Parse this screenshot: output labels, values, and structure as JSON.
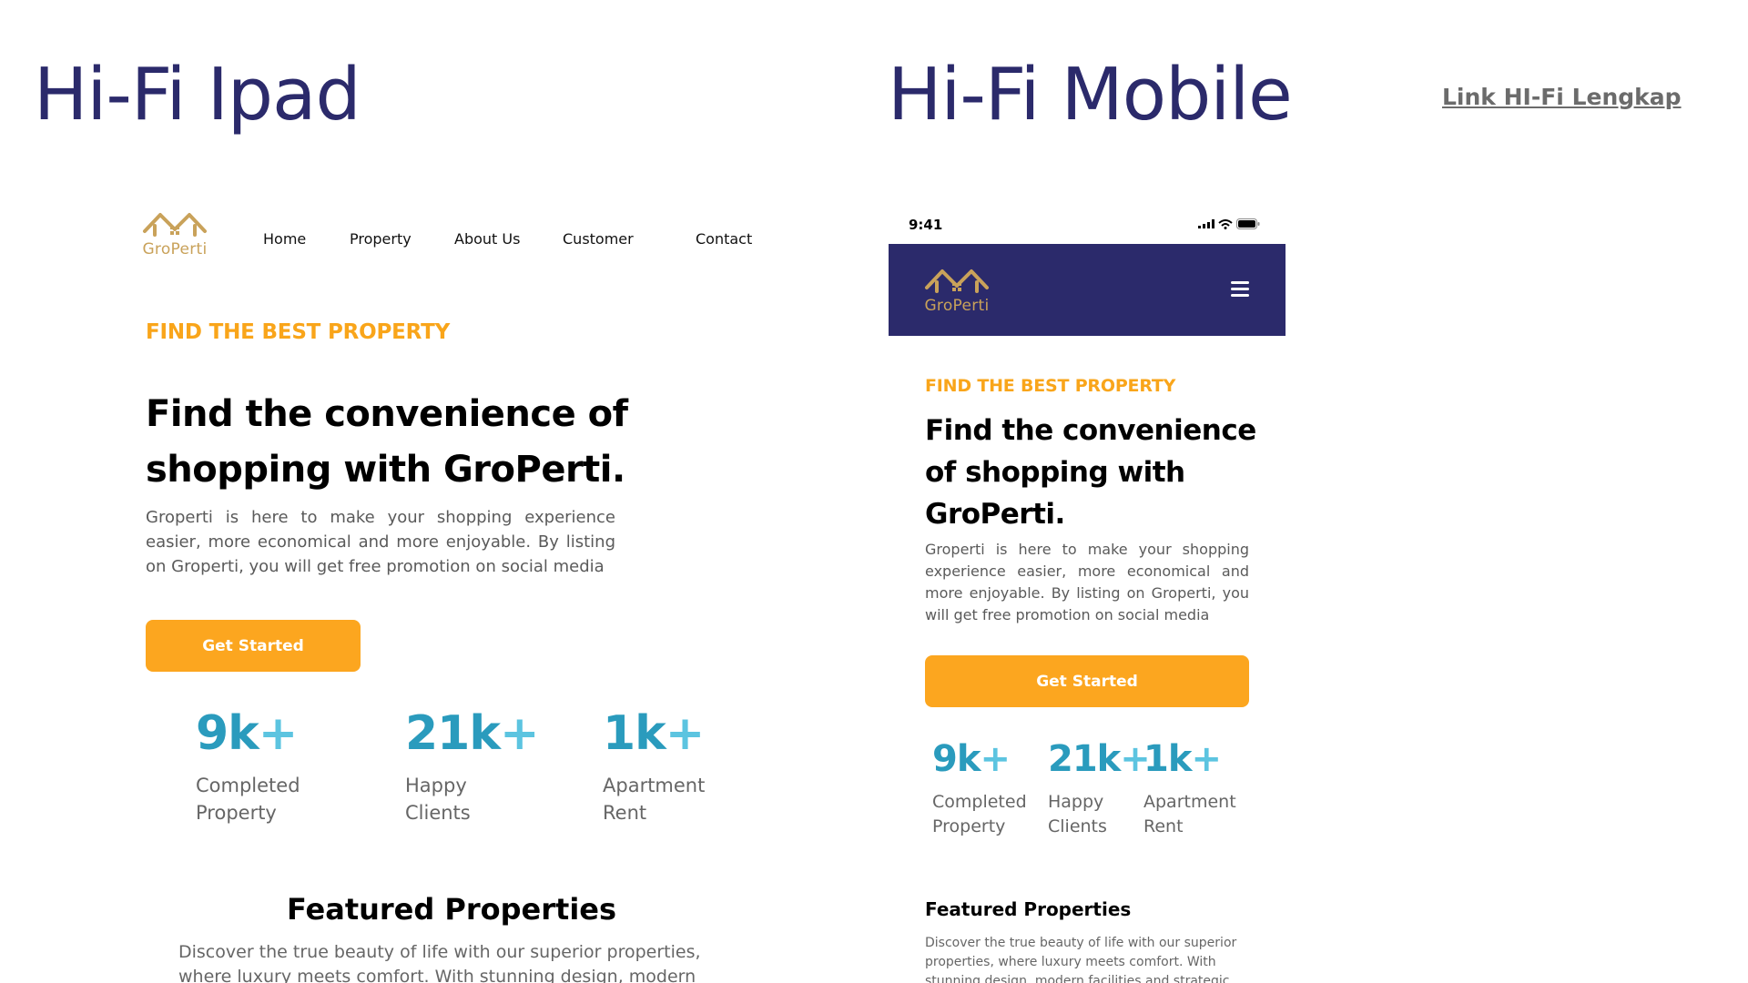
{
  "headings": {
    "ipad": "Hi-Fi Ipad",
    "mobile": "Hi-Fi Mobile",
    "link": "Link HI-Fi Lengkap"
  },
  "brand": {
    "name": "GroPerti",
    "logo_color": "#c9a25a"
  },
  "colors": {
    "primary": "#2b2a6b",
    "accent": "#fca61f",
    "stat": "#2a9bbd"
  },
  "ipad": {
    "nav": [
      "Home",
      "Property",
      "About Us",
      "Customer",
      "Contact"
    ],
    "eyebrow": "FIND THE BEST PROPERTY",
    "hero_title": "Find the convenience of shopping with GroPerti.",
    "description": "Groperti is here to make your shopping experience easier, more economical and more enjoyable. By listing on Groperti, you will get free promotion on social media",
    "cta": "Get Started",
    "stats": [
      {
        "value": "9k",
        "plus": "+",
        "label_line1": "Completed",
        "label_line2": "Property"
      },
      {
        "value": "21k",
        "plus": "+",
        "label_line1": "Happy",
        "label_line2": "Clients"
      },
      {
        "value": "1k",
        "plus": "+",
        "label_line1": "Apartment",
        "label_line2": "Rent"
      }
    ],
    "featured_title": "Featured Properties",
    "featured_desc": "Discover the true beauty of life with our superior properties, where luxury meets comfort. With stunning design, modern facilities and"
  },
  "mobile": {
    "status_time": "9:41",
    "icons": [
      "signal-icon",
      "wifi-icon",
      "battery-icon",
      "hamburger-menu-icon"
    ],
    "eyebrow": "FIND THE BEST PROPERTY",
    "hero_title": "Find the convenience of shopping with GroPerti.",
    "description": "Groperti is here to make your shopping experience easier, more economical and more enjoyable. By listing on Groperti, you will get free promotion on social media",
    "cta": "Get Started",
    "stats": [
      {
        "value": "9k",
        "plus": "+",
        "label_line1": "Completed",
        "label_line2": "Property"
      },
      {
        "value": "21k",
        "plus": "+",
        "label_line1": "Happy",
        "label_line2": "Clients"
      },
      {
        "value": "1k",
        "plus": "+",
        "label_line1": "Apartment",
        "label_line2": "Rent"
      }
    ],
    "featured_title": "Featured Properties",
    "featured_desc": "Discover the true beauty of life with our superior properties, where luxury meets comfort. With stunning design, modern facilities and strategic"
  }
}
